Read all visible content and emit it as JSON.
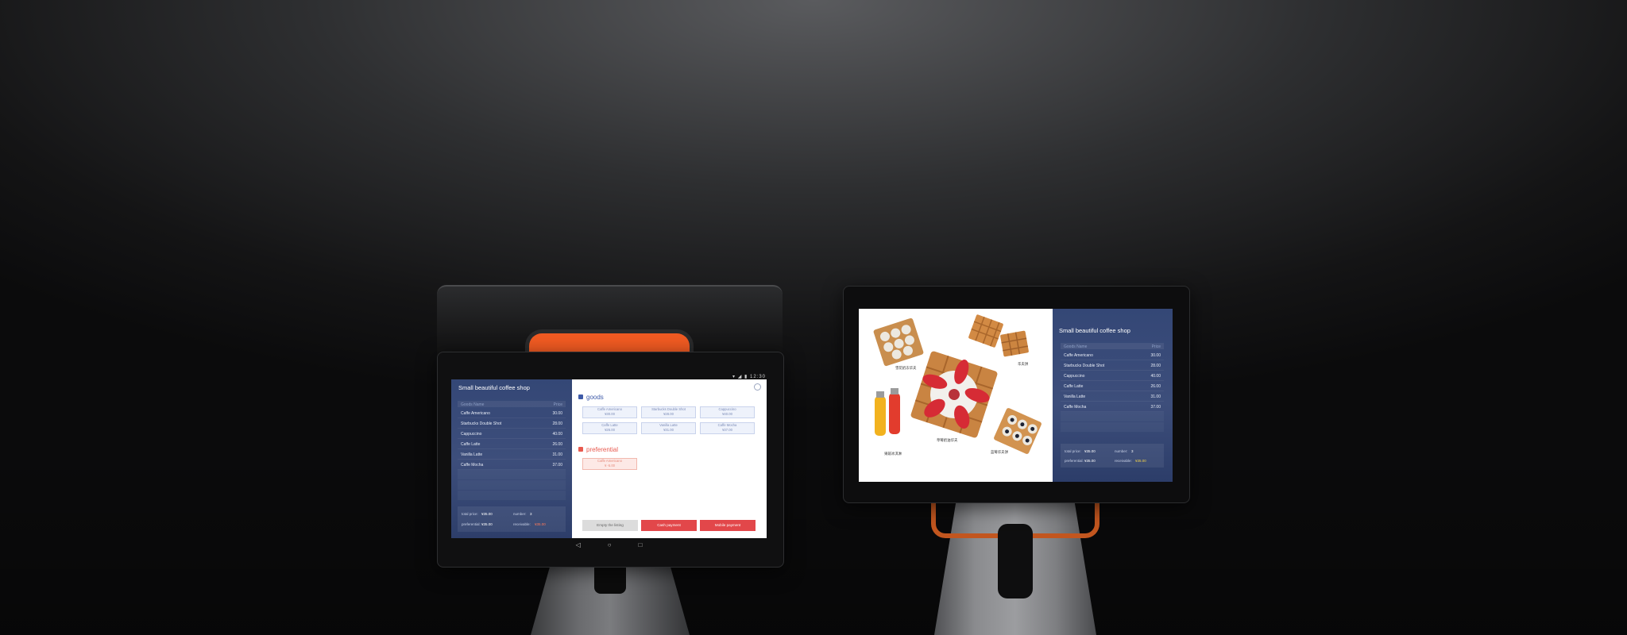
{
  "shop_title": "Small beautiful coffee shop",
  "status_bar": {
    "time": "12:30"
  },
  "order_table": {
    "col_goods": "Goods Name",
    "col_price": "Price",
    "rows": [
      {
        "name": "Caffe Americano",
        "price": "30.00"
      },
      {
        "name": "Starbucks Double Shot",
        "price": "28.00"
      },
      {
        "name": "Cappuccino",
        "price": "40.00"
      },
      {
        "name": "Caffe Latte",
        "price": "26.00"
      },
      {
        "name": "Vanilla Latte",
        "price": "31.00"
      },
      {
        "name": "Caffe Mocha",
        "price": "37.00"
      }
    ]
  },
  "totals": {
    "total_label": "total price:",
    "total_value": "¥35.00",
    "number_label": "number:",
    "number_value": "3",
    "pref_label": "preferential:",
    "pref_value": "¥35.00",
    "recv_label": "receivable:",
    "recv_value": "¥35.00"
  },
  "goods_section": {
    "title": "goods",
    "items": [
      {
        "name": "Caffe Americano",
        "price": "¥30.00"
      },
      {
        "name": "Starbucks Double Shot",
        "price": "¥28.00"
      },
      {
        "name": "Cappuccino",
        "price": "¥40.00"
      },
      {
        "name": "Caffe Latte",
        "price": "¥26.00"
      },
      {
        "name": "Vanilla Latte",
        "price": "¥31.00"
      },
      {
        "name": "Caffe Mocha",
        "price": "¥37.00"
      }
    ]
  },
  "preferential_section": {
    "title": "preferential",
    "item": {
      "name": "Caffe Americano",
      "price": "¥ -5.00"
    }
  },
  "actions": {
    "empty": "Empty the listing",
    "cash": "Cash payment",
    "mobile": "Mobile payment"
  },
  "promo_labels": {
    "top_left": "雪花奶冻华夫",
    "top_right": "华夫饼",
    "center": "草莓奶油华夫",
    "bottom_left": "果蔬冰淇淋",
    "bottom_right": "蓝莓华夫饼"
  },
  "colors": {
    "panel_blue": "#344776",
    "accent_red": "#e2474a",
    "goods_blue": "#3e5aa8",
    "device_orange": "#f05a22"
  },
  "icons": [
    "gear-icon",
    "back-icon",
    "home-icon",
    "recents-icon",
    "goods-icon",
    "preferential-icon"
  ]
}
